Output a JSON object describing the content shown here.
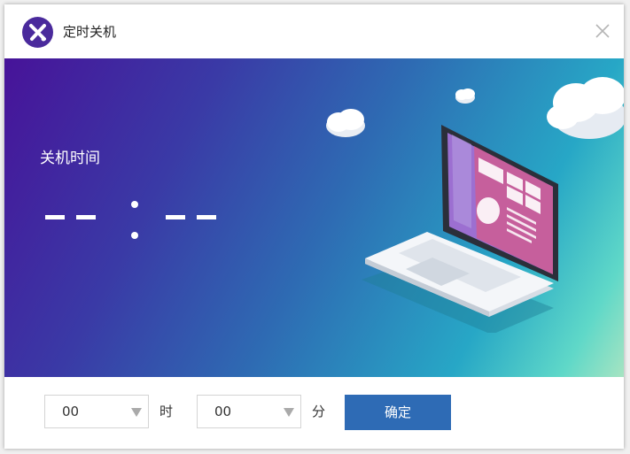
{
  "window": {
    "title": "定时关机",
    "logo_icon": "app-logo-icon",
    "close_icon": "close-icon"
  },
  "banner": {
    "label": "关机时间",
    "time_display": {
      "hours_placeholder": "— —",
      "separator": ":",
      "minutes_placeholder": "— —"
    },
    "illustration": "laptop-with-clouds"
  },
  "footer": {
    "hour_select": {
      "value": "00",
      "unit": "时"
    },
    "minute_select": {
      "value": "00",
      "unit": "分"
    },
    "confirm_label": "确定"
  },
  "colors": {
    "accent": "#2e6bb5",
    "logo": "#4a2a9c",
    "gradient_start": "#471399",
    "gradient_end": "#a6e4c2"
  }
}
